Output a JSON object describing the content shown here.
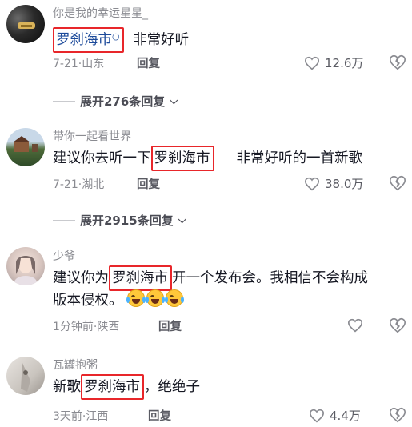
{
  "comments": [
    {
      "username": "你是我的幸运星星_",
      "text_highlight": "罗刹海市",
      "text_after": "非常好听",
      "date": "7-21",
      "location": "山东",
      "reply_label": "回复",
      "likes": "12.6万",
      "expand_label": "展开276条回复"
    },
    {
      "username": "带你一起看世界",
      "text_before": "建议你去听一下",
      "text_highlight": "罗刹海市",
      "text_after": "非常好听的一首新歌",
      "date": "7-21",
      "location": "湖北",
      "reply_label": "回复",
      "likes": "38.0万",
      "expand_label": "展开2915条回复"
    },
    {
      "username": "少爷",
      "text_before": "建议你为",
      "text_highlight": "罗刹海市",
      "text_after": "开一个发布会。我相信不会构成",
      "text_line2": "版本侵权。",
      "emoji_count": 3,
      "date": "1分钟前",
      "location": "陕西",
      "reply_label": "回复"
    },
    {
      "username": "瓦罐抱粥",
      "text_before": "新歌",
      "text_highlight": "罗刹海市",
      "text_after": "，绝绝子",
      "date": "3天前",
      "location": "江西",
      "reply_label": "回复",
      "likes": "4.4万"
    }
  ],
  "meta_separator": "·",
  "colors": {
    "highlight_border": "#e8262a",
    "link_blue": "#1c4a9a",
    "muted": "#8a8b91"
  }
}
